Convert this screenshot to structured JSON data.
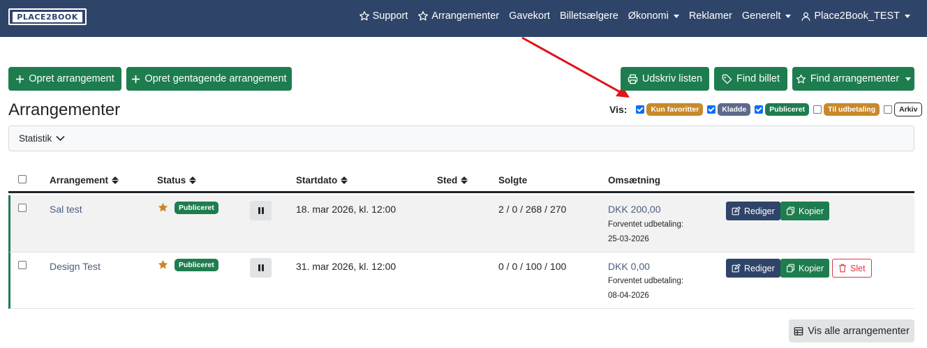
{
  "nav": {
    "logo": "PLACE2BOOK",
    "items": [
      {
        "label": "Support",
        "icon": "star-icon"
      },
      {
        "label": "Arrangementer",
        "icon": "star-icon"
      },
      {
        "label": "Gavekort"
      },
      {
        "label": "Billetsælgere"
      },
      {
        "label": "Økonomi",
        "dropdown": true
      },
      {
        "label": "Reklamer"
      },
      {
        "label": "Generelt",
        "dropdown": true
      },
      {
        "label": "Place2Book_TEST",
        "icon": "user-icon",
        "dropdown": true
      }
    ]
  },
  "actions": {
    "create": "Opret arrangement",
    "create_recurring": "Opret gentagende arrangement",
    "print": "Udskriv listen",
    "find_ticket": "Find billet",
    "find_events": "Find arrangementer"
  },
  "page_title": "Arrangementer",
  "filter": {
    "label": "Vis:",
    "options": [
      {
        "label": "Kun favoritter",
        "checked": true,
        "color": "#c8892a"
      },
      {
        "label": "Kladde",
        "checked": true,
        "color": "#5d6a8a"
      },
      {
        "label": "Publiceret",
        "checked": true,
        "color": "#1e7d4f"
      },
      {
        "label": "Til udbetaling",
        "checked": false,
        "color": "#c8892a"
      },
      {
        "label": "Arkiv",
        "checked": false,
        "color": "#ffffff"
      }
    ]
  },
  "stats": {
    "label": "Statistik"
  },
  "table": {
    "headers": {
      "event": "Arrangement",
      "status": "Status",
      "start": "Startdato",
      "place": "Sted",
      "sold": "Solgte",
      "revenue": "Omsætning"
    },
    "rows": [
      {
        "name": "Sal test",
        "status": "Publiceret",
        "start": "18. mar 2026, kl. 12:00",
        "place": "",
        "sold": "2 / 0 / 268 / 270",
        "revenue": "DKK 200,00",
        "payout_label": "Forventet udbetaling:",
        "payout_date": "25-03-2026",
        "edit": "Rediger",
        "copy": "Kopier"
      },
      {
        "name": "Design Test",
        "status": "Publiceret",
        "start": "31. mar 2026, kl. 12:00",
        "place": "",
        "sold": "0 / 0 / 100 / 100",
        "revenue": "DKK 0,00",
        "payout_label": "Forventet udbetaling:",
        "payout_date": "08-04-2026",
        "edit": "Rediger",
        "copy": "Kopier",
        "delete": "Slet"
      }
    ]
  },
  "show_all": "Vis alle arrangementer",
  "colors": {
    "navbar": "#2f4469",
    "primary": "#1e7d4f",
    "favorite": "#c8892a",
    "danger": "#dc3545"
  }
}
